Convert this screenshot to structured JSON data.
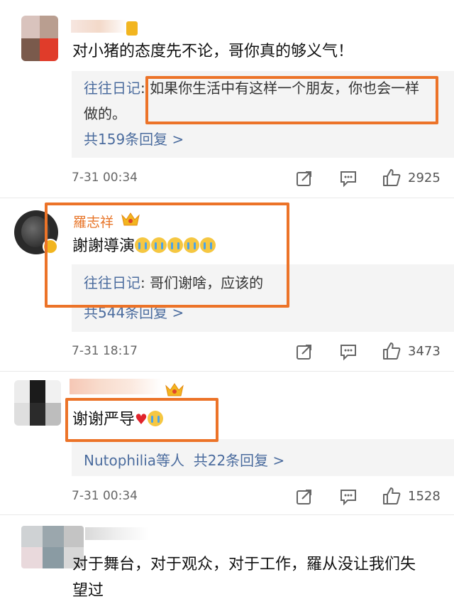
{
  "comments": [
    {
      "username": "",
      "text": "对小猪的态度先不论，哥你真的够义气！",
      "reply_author": "往往日记",
      "reply_text": "如果你生活中有这样一个朋友，你也会一样做的。",
      "reply_line1": "如果你生活中有这样一个朋友，你也会一样",
      "reply_line2": "做的。",
      "more": "共159条回复 >",
      "time": "7-31 00:34",
      "likes": "2925"
    },
    {
      "username": "羅志祥",
      "text": "謝謝導演",
      "emoji_count": 5,
      "reply_author": "往往日记",
      "reply_text": "哥们谢啥，应该的",
      "more": "共544条回复 >",
      "time": "7-31 18:17",
      "likes": "3473"
    },
    {
      "username": "",
      "text": "谢谢严导",
      "more_prefix": "Nutophilia等人",
      "more": "共22条回复 >",
      "time": "7-31 00:34",
      "likes": "1528"
    },
    {
      "username": "",
      "text": "对于舞台，对于观众，对于工作，羅从没让我们失望过",
      "text_line1": "对于舞台，对于观众，对于工作，羅从没让我们失",
      "text_line2": "望过"
    }
  ],
  "icons": [
    "share-icon",
    "comment-icon",
    "like-icon",
    "crown-icon",
    "verified-icon",
    "crying-emoji-icon",
    "heart-emoji-icon"
  ],
  "colors": {
    "highlight": "#ec7328",
    "username": "#e8762a",
    "link": "#4b6c9e",
    "crown": "#f2b51f"
  }
}
